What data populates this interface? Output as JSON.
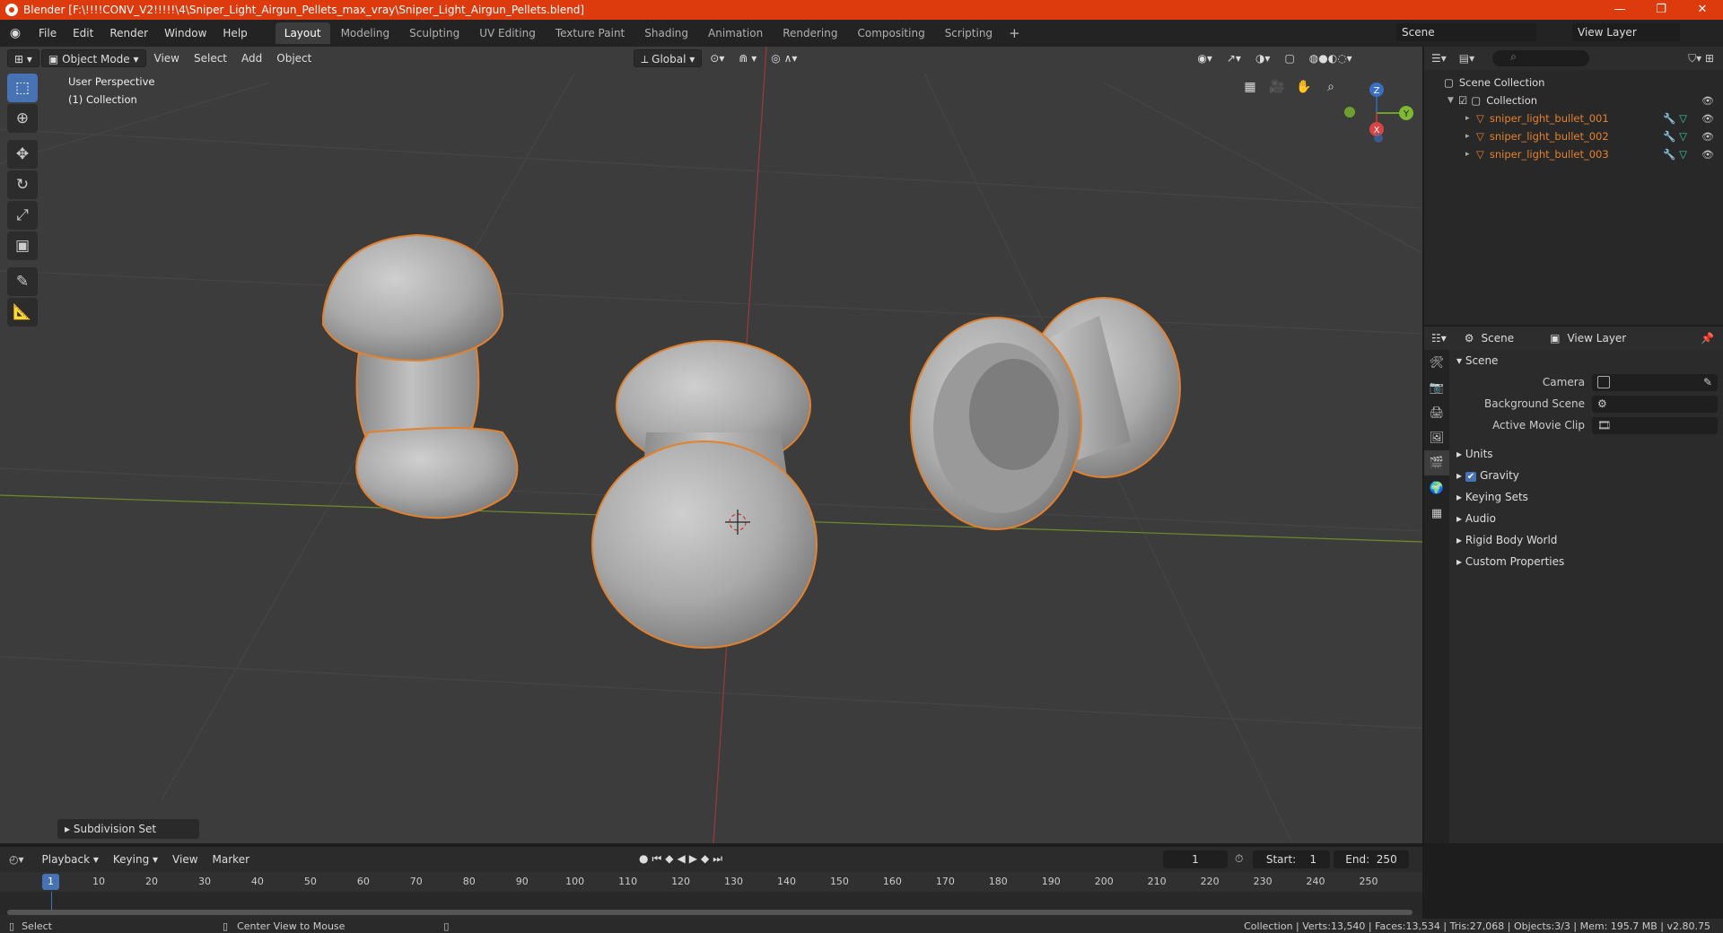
{
  "window": {
    "title": "Blender [F:\\!!!!CONV_V2!!!!!\\4\\Sniper_Light_Airgun_Pellets_max_vray\\Sniper_Light_Airgun_Pellets.blend]",
    "minimize": "—",
    "maximize": "❐",
    "close": "✕"
  },
  "menu": [
    "File",
    "Edit",
    "Render",
    "Window",
    "Help"
  ],
  "workspaces": [
    "Layout",
    "Modeling",
    "Sculpting",
    "UV Editing",
    "Texture Paint",
    "Shading",
    "Animation",
    "Rendering",
    "Compositing",
    "Scripting"
  ],
  "workspace_active": "Layout",
  "workspace_add": "+",
  "scene_name": "Scene",
  "view_layer": "View Layer",
  "viewport": {
    "mode": "Object Mode",
    "menus": [
      "View",
      "Select",
      "Add",
      "Object"
    ],
    "orientation": "Global",
    "perspective_label": "User Perspective",
    "collection_label": "(1) Collection",
    "operator_panel": "Subdivision Set",
    "gizmo": {
      "x": "X",
      "y": "Y",
      "z": "Z"
    }
  },
  "outliner": {
    "root": "Scene Collection",
    "collection": "Collection",
    "objects": [
      "sniper_light_bullet_001",
      "sniper_light_bullet_002",
      "sniper_light_bullet_003"
    ]
  },
  "properties": {
    "tab_scene": "Scene",
    "tab_view_layer": "View Layer",
    "section_scene": "Scene",
    "fields": [
      {
        "label": "Camera"
      },
      {
        "label": "Background Scene"
      },
      {
        "label": "Active Movie Clip"
      }
    ],
    "panels": [
      "Units",
      "Gravity",
      "Keying Sets",
      "Audio",
      "Rigid Body World",
      "Custom Properties"
    ]
  },
  "timeline": {
    "menus": [
      "Playback",
      "Keying",
      "View",
      "Marker"
    ],
    "current_frame": "1",
    "start_label": "Start:",
    "start": "1",
    "end_label": "End:",
    "end": "250",
    "ticks": [
      "1",
      "10",
      "20",
      "30",
      "40",
      "50",
      "60",
      "70",
      "80",
      "90",
      "100",
      "110",
      "120",
      "130",
      "140",
      "150",
      "160",
      "170",
      "180",
      "190",
      "200",
      "210",
      "220",
      "230",
      "240",
      "250"
    ]
  },
  "status": {
    "left_action": "Select",
    "middle_action": "Center View to Mouse",
    "stats": "Collection | Verts:13,540 | Faces:13,534 | Tris:27,068 | Objects:3/3 | Mem: 195.7 MB | v2.80.75"
  },
  "colors": {
    "title_bar": "#dd3b0e",
    "selection_outline": "#e3812d",
    "active_blue": "#4772b3"
  }
}
